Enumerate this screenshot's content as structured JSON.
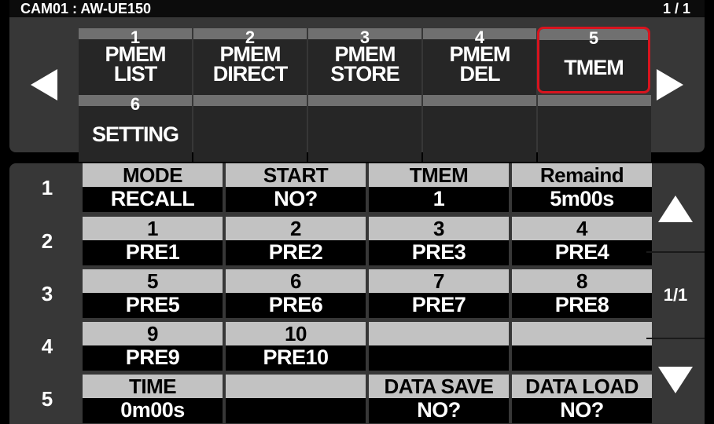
{
  "title": "CAM01 : AW-UE150",
  "page": "1 / 1",
  "tabs": [
    {
      "num": "1",
      "label": "PMEM LIST"
    },
    {
      "num": "2",
      "label": "PMEM DIRECT"
    },
    {
      "num": "3",
      "label": "PMEM STORE"
    },
    {
      "num": "4",
      "label": "PMEM DEL"
    },
    {
      "num": "5",
      "label": "TMEM"
    },
    {
      "num": "6",
      "label": "SETTING"
    }
  ],
  "active_tab": "5",
  "rows": [
    {
      "label": "1",
      "cells": [
        {
          "top": "MODE",
          "bottom": "RECALL"
        },
        {
          "top": "START",
          "bottom": "NO?"
        },
        {
          "top": "TMEM",
          "bottom": "1"
        },
        {
          "top": "Remaind",
          "bottom": "5m00s"
        }
      ]
    },
    {
      "label": "2",
      "cells": [
        {
          "top": "1",
          "bottom": "PRE1"
        },
        {
          "top": "2",
          "bottom": "PRE2"
        },
        {
          "top": "3",
          "bottom": "PRE3"
        },
        {
          "top": "4",
          "bottom": "PRE4"
        }
      ]
    },
    {
      "label": "3",
      "cells": [
        {
          "top": "5",
          "bottom": "PRE5"
        },
        {
          "top": "6",
          "bottom": "PRE6"
        },
        {
          "top": "7",
          "bottom": "PRE7"
        },
        {
          "top": "8",
          "bottom": "PRE8"
        }
      ]
    },
    {
      "label": "4",
      "cells": [
        {
          "top": "9",
          "bottom": "PRE9"
        },
        {
          "top": "10",
          "bottom": "PRE10"
        },
        {
          "top": "",
          "bottom": ""
        },
        {
          "top": "",
          "bottom": ""
        }
      ]
    },
    {
      "label": "5",
      "cells": [
        {
          "top": "TIME",
          "bottom": "0m00s"
        },
        {
          "top": "",
          "bottom": ""
        },
        {
          "top": "DATA SAVE",
          "bottom": "NO?"
        },
        {
          "top": "DATA LOAD",
          "bottom": "NO?"
        }
      ]
    }
  ],
  "page_indicator": "1/1",
  "icons": {
    "prev": "left-arrow-icon",
    "next": "right-arrow-icon",
    "up": "up-arrow-icon",
    "down": "down-arrow-icon"
  },
  "colors": {
    "active_border": "#d8141e",
    "panel": "#373737",
    "header": "#c2c2c2"
  }
}
